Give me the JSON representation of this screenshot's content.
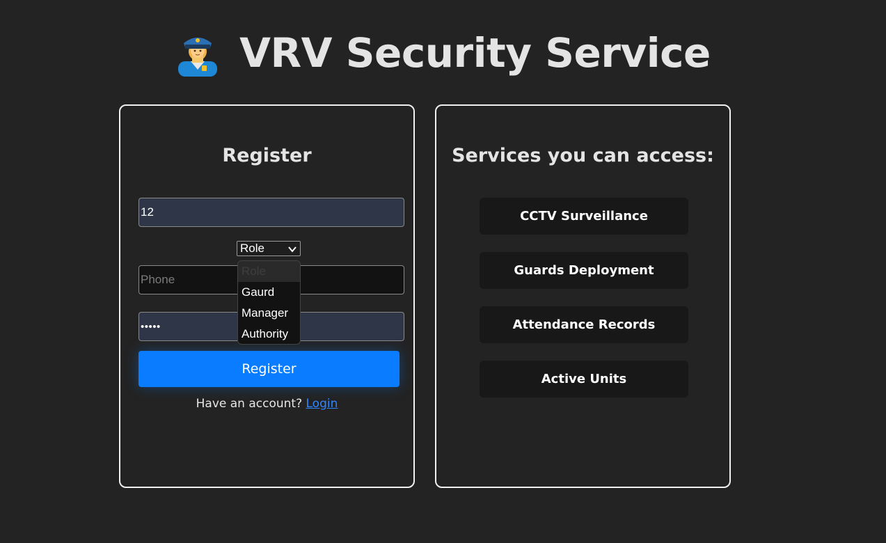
{
  "header": {
    "title": "VRV Security Service",
    "logo_icon": "police-officer-icon"
  },
  "register": {
    "title": "Register",
    "username_value": "12",
    "role_select_value": "Role",
    "role_options": [
      "Role",
      "Gaurd",
      "Manager",
      "Authority"
    ],
    "phone_placeholder": "Phone",
    "password_value": "•••••",
    "submit_label": "Register",
    "account_prompt": "Have an account?",
    "login_link": "Login"
  },
  "services": {
    "title": "Services you can access:",
    "items": [
      "CCTV Surveillance",
      "Guards Deployment",
      "Attendance Records",
      "Active Units"
    ]
  },
  "colors": {
    "background": "#232323",
    "accent": "#0a7cff",
    "link": "#2f86ff",
    "card_border": "#f0f0f0",
    "filled_input": "#2f3647"
  }
}
